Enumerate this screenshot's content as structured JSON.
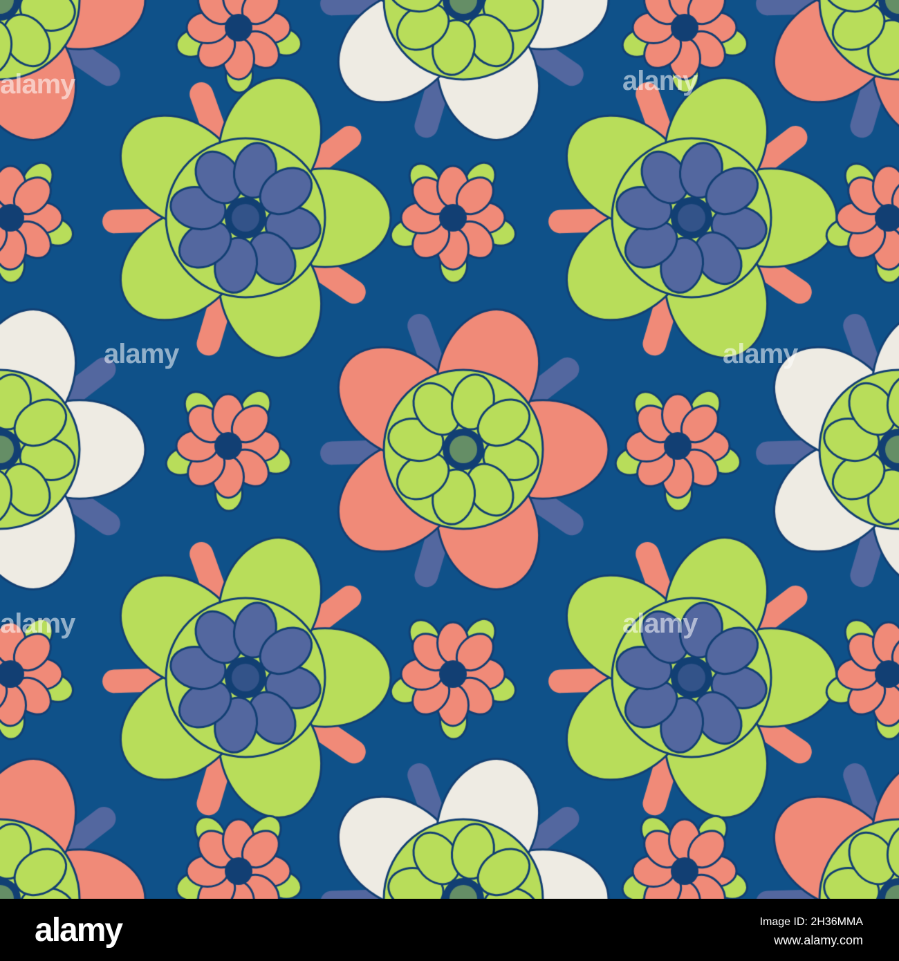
{
  "colors": {
    "background": "#0f5189",
    "green": "#b8dd5a",
    "coral": "#f08a78",
    "periwinkle": "#53679f",
    "cream": "#eeebe3",
    "outline": "#123f73"
  },
  "watermark": "alamy",
  "footer": {
    "logo": "alamy",
    "image_id": "Image ID: 2H36MMA",
    "url": "www.alamy.com"
  }
}
